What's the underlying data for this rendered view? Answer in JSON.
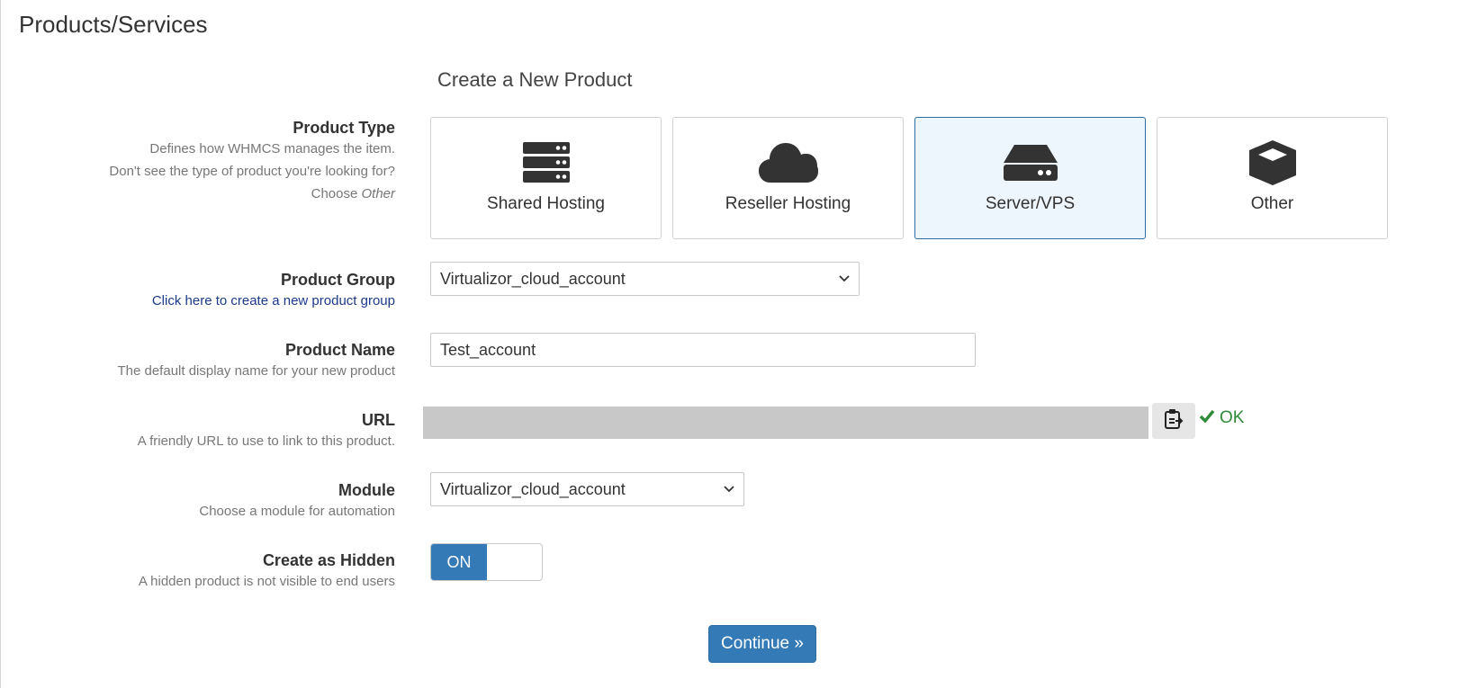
{
  "page": {
    "title": "Products/Services"
  },
  "form": {
    "title": "Create a New Product",
    "product_type": {
      "label": "Product Type",
      "desc_line1": "Defines how WHMCS manages the item.",
      "desc_line2": "Don't see the type of product you're looking for?",
      "desc_line3_prefix": "Choose ",
      "desc_line3_em": "Other",
      "options": [
        {
          "label": "Shared Hosting",
          "icon": "server-stack-icon",
          "selected": false
        },
        {
          "label": "Reseller Hosting",
          "icon": "cloud-icon",
          "selected": false
        },
        {
          "label": "Server/VPS",
          "icon": "hdd-icon",
          "selected": true
        },
        {
          "label": "Other",
          "icon": "cube-icon",
          "selected": false
        }
      ]
    },
    "product_group": {
      "label": "Product Group",
      "link_text": "Click here to create a new product group",
      "value": "Virtualizor_cloud_account"
    },
    "product_name": {
      "label": "Product Name",
      "desc": "The default display name for your new product",
      "value": "Test_account"
    },
    "url": {
      "label": "URL",
      "desc": "A friendly URL to use to link to this product.",
      "value": "",
      "status": "OK"
    },
    "module": {
      "label": "Module",
      "desc": "Choose a module for automation",
      "value": "Virtualizor_cloud_account"
    },
    "create_hidden": {
      "label": "Create as Hidden",
      "desc": "A hidden product is not visible to end users",
      "toggle_text": "ON",
      "value": true
    },
    "continue_label": "Continue »"
  },
  "colors": {
    "primary": "#337ab7",
    "selected_tile_bg": "#eef6fd",
    "ok_green": "#2e8b3a",
    "link": "#1b3a8a"
  }
}
